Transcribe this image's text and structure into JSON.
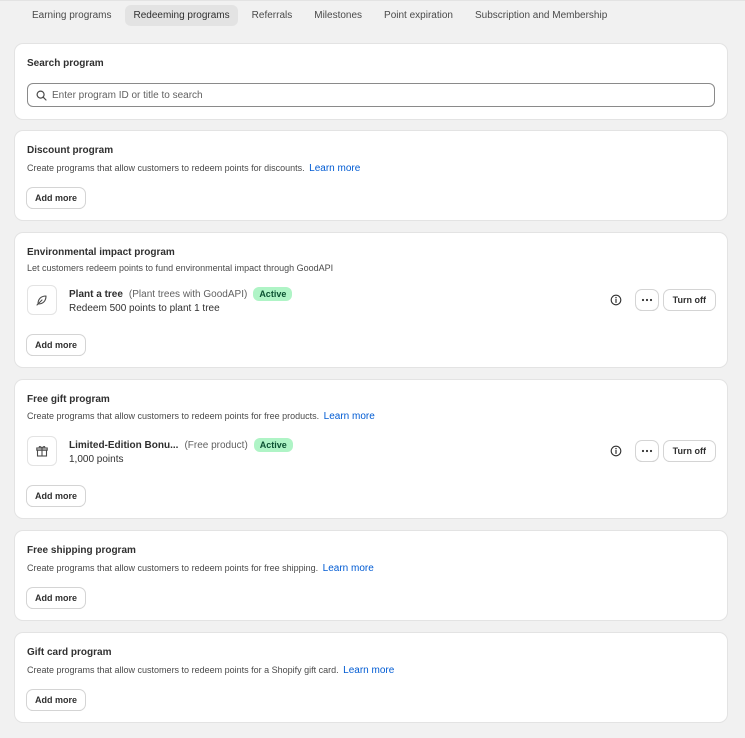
{
  "tabs": [
    {
      "label": "Earning programs"
    },
    {
      "label": "Redeeming programs"
    },
    {
      "label": "Referrals"
    },
    {
      "label": "Milestones"
    },
    {
      "label": "Point expiration"
    },
    {
      "label": "Subscription and Membership"
    }
  ],
  "active_tab": "Redeeming programs",
  "search": {
    "title": "Search program",
    "placeholder": "Enter program ID or title to search",
    "value": ""
  },
  "discount": {
    "title": "Discount program",
    "description": "Create programs that allow customers to redeem points for discounts.",
    "link": "Learn more",
    "add_label": "Add more"
  },
  "environmental": {
    "title": "Environmental impact program",
    "description": "Let customers redeem points to fund environmental impact through GoodAPI",
    "item": {
      "icon": "leaf-icon",
      "title": "Plant a tree",
      "subtitle": "(Plant trees with GoodAPI)",
      "status": "Active",
      "detail": "Redeem 500 points to plant 1 tree",
      "turn_off_label": "Turn off"
    },
    "add_label": "Add more"
  },
  "free_gift": {
    "title": "Free gift program",
    "description": "Create programs that allow customers to redeem points for free products.",
    "link": "Learn more",
    "item": {
      "icon": "gift-icon",
      "title": "Limited-Edition Bonu...",
      "subtitle": "(Free product)",
      "status": "Active",
      "detail": "1,000 points",
      "turn_off_label": "Turn off"
    },
    "add_label": "Add more"
  },
  "free_shipping": {
    "title": "Free shipping program",
    "description": "Create programs that allow customers to redeem points for free shipping.",
    "link": "Learn more",
    "add_label": "Add more"
  },
  "gift_card": {
    "title": "Gift card program",
    "description": "Create programs that allow customers to redeem points for a Shopify gift card.",
    "link": "Learn more",
    "add_label": "Add more"
  },
  "colors": {
    "accent_link": "#005bd3",
    "badge_bg": "#aff4c6",
    "badge_text": "#0c5132",
    "page_bg": "#f1f1f1"
  }
}
